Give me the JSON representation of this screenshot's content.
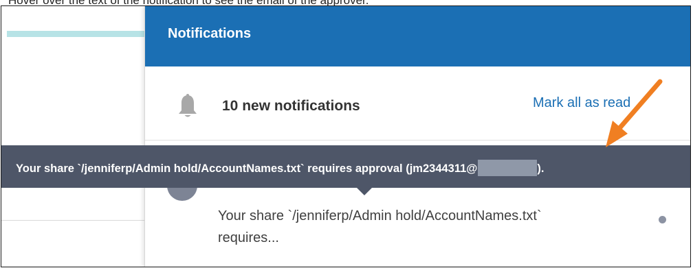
{
  "caption": "Hover over the text of the notification to see the email of the approver.",
  "notifications_panel": {
    "title": "Notifications",
    "new_count_text": "10 new notifications",
    "mark_all_label": "Mark all as read"
  },
  "notification_item": {
    "text": "Your share `/jenniferp/Admin hold/AccountNames.txt` requires..."
  },
  "tooltip": {
    "text_before_redaction": "Your share `/jenniferp/Admin hold/AccountNames.txt` requires approval (jm2344311@",
    "text_after_redaction": ")."
  },
  "icons": {
    "bell": "bell-icon",
    "annotation_arrow": "arrow-icon"
  },
  "colors": {
    "header_blue": "#1b6fb4",
    "tooltip_bg": "#4e5668",
    "annotation_orange": "#f07f22",
    "link_blue": "#1b6fb4"
  }
}
